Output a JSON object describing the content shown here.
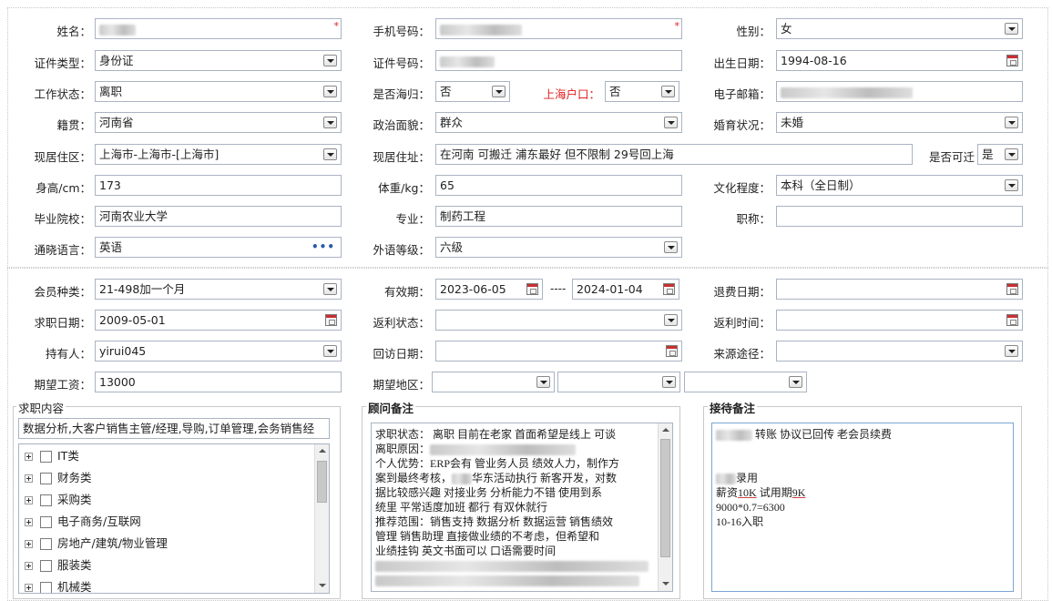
{
  "basic": {
    "name_label": "姓名：",
    "phone_label": "手机号码：",
    "gender_label": "性别：",
    "gender_value": "女",
    "idtype_label": "证件类型：",
    "idtype_value": "身份证",
    "idno_label": "证件号码：",
    "birth_label": "出生日期：",
    "birth_value": "1994-08-16",
    "workstatus_label": "工作状态：",
    "workstatus_value": "离职",
    "returnee_label": "是否海归：",
    "returnee_value": "否",
    "hukou_label": "上海户口：",
    "hukou_value": "否",
    "email_label": "电子邮箱：",
    "native_label": "籍贯：",
    "native_value": "河南省",
    "political_label": "政治面貌：",
    "political_value": "群众",
    "marital_label": "婚育状况：",
    "marital_value": "未婚",
    "area_label": "现居住区：",
    "area_value": "上海市-上海市-[上海市]",
    "address_label": "现居住址：",
    "address_value": "在河南  可搬迁  浦东最好 但不限制   29号回上海",
    "relocate_label": "是否可迁",
    "relocate_value": "是",
    "height_label": "身高/cm：",
    "height_value": "173",
    "weight_label": "体重/kg：",
    "weight_value": "65",
    "education_label": "文化程度：",
    "education_value": "本科（全日制）",
    "school_label": "毕业院校：",
    "school_value": "河南农业大学",
    "major_label": "专业：",
    "major_value": "制药工程",
    "title_label": "职称：",
    "title_value": "",
    "language_label": "通晓语言：",
    "language_value": "英语",
    "langlevel_label": "外语等级：",
    "langlevel_value": "六级"
  },
  "member": {
    "type_label": "会员种类：",
    "type_value": "21-498加一个月",
    "valid_label": "有效期：",
    "valid_from": "2023-06-05",
    "valid_sep": "----",
    "valid_to": "2024-01-04",
    "refund_label": "退费日期：",
    "refund_value": "",
    "jobdate_label": "求职日期：",
    "jobdate_value": "2009-05-01",
    "rebate_status_label": "返利状态：",
    "rebate_status_value": "",
    "rebate_time_label": "返利时间：",
    "rebate_time_value": "",
    "holder_label": "持有人：",
    "holder_value": "yirui045",
    "visit_label": "回访日期：",
    "visit_value": "",
    "source_label": "来源途径：",
    "source_value": "",
    "salary_label": "期望工资：",
    "salary_value": "13000",
    "region_label": "期望地区："
  },
  "job_content": {
    "title": "求职内容",
    "summary": "数据分析,大客户销售主管/经理,导购,订单管理,会务销售经",
    "categories": [
      "IT类",
      "财务类",
      "采购类",
      "电子商务/互联网",
      "房地产/建筑/物业管理",
      "服装类",
      "机械类"
    ]
  },
  "advisor_notes": {
    "title": "顾问备注",
    "l1": "求职状态： 离职 目前在老家 首面希望是线上 可谈",
    "l2": "离职原因：",
    "l3a": "个人优势：ERP会有 管业务人员 绩效人力，制作方",
    "l4a": "案到最终考核，",
    "l4b": "华东活动执行 新客开发，对数",
    "l5": "据比较感兴趣  对接业务  分析能力不错 使用到系",
    "l6": "统里  平常适度加班 都行 有双休就行",
    "l7": "推荐范围：销售支持 数据分析 数据运营 销售绩效",
    "l8": "管理  销售助理    直接做业绩的不考虑，但希望和",
    "l9": "业绩挂钩 英文书面可以 口语需要时间"
  },
  "reception_notes": {
    "title": "接待备注",
    "l1": "转账 协议已回传 老会员续费",
    "l2": "录用",
    "l3a": "薪资",
    "l3b": "10K",
    "l3c": "  试用期",
    "l3d": "9K",
    "l4": "9000*0.7=6300",
    "l5": "10-16入职"
  }
}
